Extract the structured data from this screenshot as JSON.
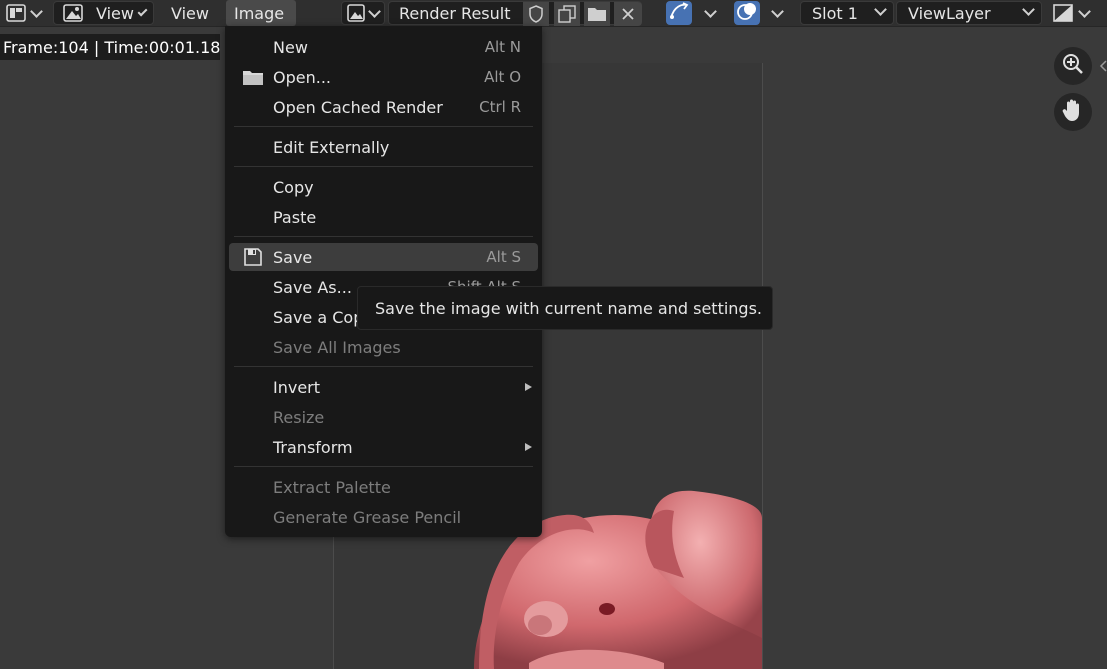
{
  "header": {
    "editor_view_label": "View",
    "view_menu_label": "View",
    "image_menu_label": "Image",
    "image_name": "Render Result",
    "slot_label": "Slot 1",
    "layer_label": "ViewLayer"
  },
  "info_bar": {
    "frame_text": "Frame:104 | Time:00:01.18"
  },
  "image_menu": {
    "items": [
      {
        "label": "New",
        "shortcut": "Alt N"
      },
      {
        "label": "Open...",
        "shortcut": "Alt O",
        "icon": "folder-icon"
      },
      {
        "label": "Open Cached Render",
        "shortcut": "Ctrl R"
      },
      {
        "label": "Edit Externally",
        "shortcut": ""
      },
      {
        "label": "Copy",
        "shortcut": ""
      },
      {
        "label": "Paste",
        "shortcut": ""
      },
      {
        "label": "Save",
        "shortcut": "Alt S",
        "icon": "save-icon"
      },
      {
        "label": "Save As...",
        "shortcut": "Shift Alt S"
      },
      {
        "label": "Save a Copy...",
        "shortcut": ""
      },
      {
        "label": "Save All Images",
        "shortcut": ""
      },
      {
        "label": "Invert",
        "shortcut": ""
      },
      {
        "label": "Resize",
        "shortcut": ""
      },
      {
        "label": "Transform",
        "shortcut": ""
      },
      {
        "label": "Extract Palette",
        "shortcut": ""
      },
      {
        "label": "Generate Grease Pencil",
        "shortcut": ""
      }
    ]
  },
  "tooltip": {
    "text": "Save the image with current name and settings."
  },
  "colors": {
    "accent_blue": "#4772b3",
    "menu_bg": "#181818",
    "highlight_bg": "#3d3d3d",
    "model_pink": "#d7777b"
  }
}
